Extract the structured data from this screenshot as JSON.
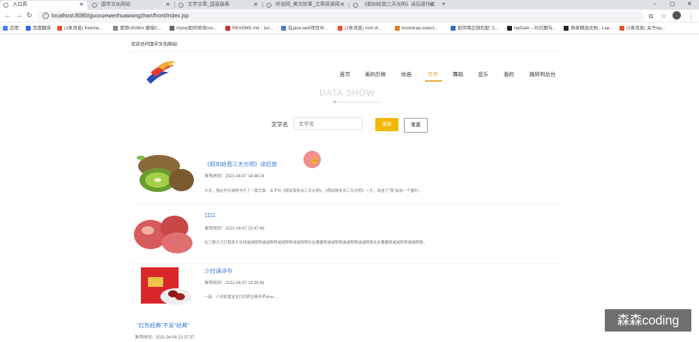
{
  "browser": {
    "tabs": [
      {
        "label": "入口页",
        "active": true
      },
      {
        "label": "国学文化网站",
        "active": false
      },
      {
        "label": "文学文章_国直链表",
        "active": false
      },
      {
        "label": "听说网_美文故事_文章阅读网",
        "active": false
      },
      {
        "label": "《假如给我三天光明》读后感作文",
        "active": false
      }
    ],
    "new_tab": "+",
    "window_controls": {
      "minimize": "–",
      "maximize": "▢",
      "close": "✕"
    },
    "url": "localhost:8080/guoxuewenhuawangzhan/front/index.jsp",
    "bookmarks": [
      {
        "label": "应用",
        "color": "#4285f4"
      },
      {
        "label": "百度翻译",
        "color": "#2b6de8"
      },
      {
        "label": "(1条消息) freema...",
        "color": "#e8552e"
      },
      {
        "label": "使用UEditor 报错C...",
        "color": "#888888"
      },
      {
        "label": "mysql如何修改roo...",
        "color": "#666666"
      },
      {
        "label": "README.md · 1er...",
        "color": "#c53030"
      },
      {
        "label": "在java web项目中...",
        "color": "#4a7fd4"
      },
      {
        "label": "(1条消息) root of...",
        "color": "#e8552e"
      },
      {
        "label": "bootstrap-select...",
        "color": "#e07b20"
      },
      {
        "label": "如何用正则匹配: 2...",
        "color": "#3366cc"
      },
      {
        "label": "layDate - JS日期与...",
        "color": "#222222"
      },
      {
        "label": "表单精选文档 - Lay...",
        "color": "#222222"
      },
      {
        "label": "(1条消息) 关于lay...",
        "color": "#e8552e"
      }
    ]
  },
  "site": {
    "welcome": "欢迎访问国学文化网站!",
    "nav": [
      {
        "label": "首页",
        "active": false
      },
      {
        "label": "美的历程",
        "active": false
      },
      {
        "label": "绘画",
        "active": false
      },
      {
        "label": "文学",
        "active": true
      },
      {
        "label": "舞蹈",
        "active": false
      },
      {
        "label": "音乐",
        "active": false
      },
      {
        "label": "我的",
        "active": false
      },
      {
        "label": "跳转到后台",
        "active": false
      }
    ],
    "accent_color": "#e8a33a",
    "section_heading": "DATA SHOW",
    "search": {
      "label": "文学名",
      "placeholder": "文学名",
      "search_button": "搜索",
      "reset_button": "重置"
    },
    "articles": [
      {
        "title": "《假如给我三天光明》读后感",
        "time": "发布时间：2021-04-07 18:48:24",
        "desc": "今天，我在作文辅导书子了一篇文章。名字叫《假如我失去三天光明》。《假如我失去三天光明》一文，讲述了\"我\"会用一个看时...",
        "thumb": "kiwi"
      },
      {
        "title": "1111",
        "time": "发布时间：2021-04-07 15:47:49",
        "desc": "在三数大刀打我串方法线减减税税减减税税减减税税减减税税反反覆覆税减减税税减减税税减减税税反反覆覆税减减税税减减税税...",
        "thumb": "apple"
      },
      {
        "title": "少时诵诗书",
        "time": "发布时间：2021-04-07 13:39:36",
        "desc": "一起。人的欲望至在打的萨达看多萨dhas ...",
        "thumb": "dates"
      }
    ],
    "last_article": {
      "title": "\"红色经典\"不是\"经典\"",
      "time": "发布时间：2021-04-06 21:37:27"
    }
  },
  "watermark": "森森coding"
}
